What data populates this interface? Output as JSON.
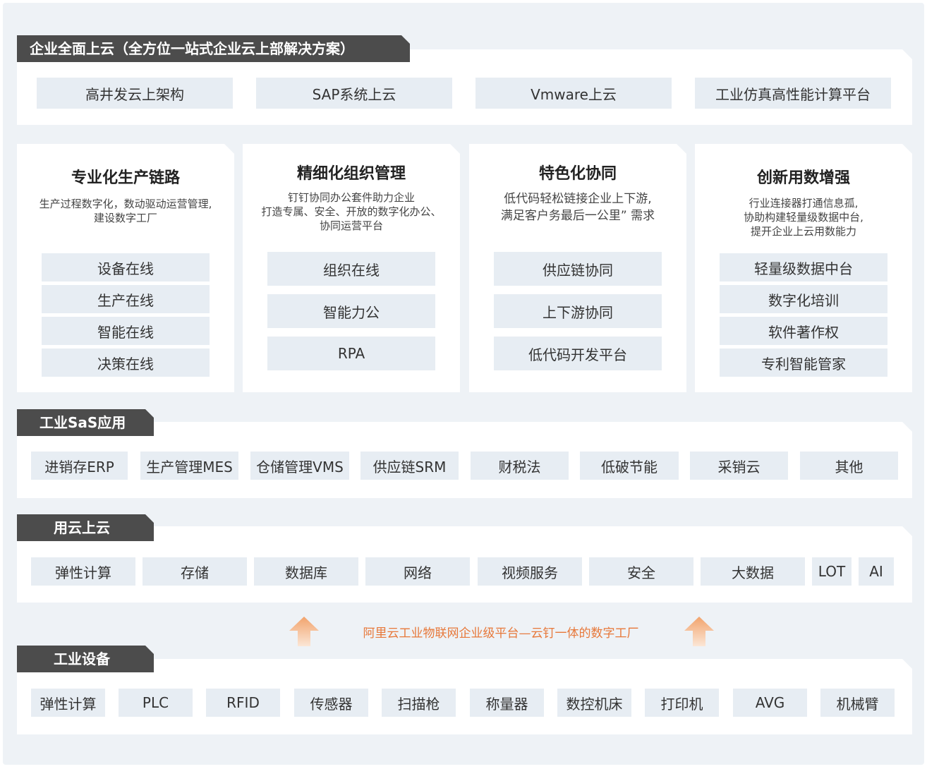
{
  "cloud_section": {
    "title": "企业全面上云（全方位一站式企业云上部解决方案）",
    "items": [
      "高井发云上架构",
      "SAP系统上云",
      "Vmware上云",
      "工业仿真高性能计算平台"
    ]
  },
  "cards": [
    {
      "title": "专业化生产链路",
      "desc": [
        "生产过程数字化，数动驱动运营管理,",
        "建设数字工厂"
      ],
      "items": [
        "设备在线",
        "生产在线",
        "智能在线",
        "决策在线"
      ]
    },
    {
      "title": "精细化组织管理",
      "desc": [
        "钉钉协同办公套件助力企业",
        "打造专属、安全、开放的数字化办公、",
        "协同运营平台"
      ],
      "items": [
        "组织在线",
        "智能力公",
        "RPA"
      ]
    },
    {
      "title": "特色化协同",
      "desc": [
        "低代码轻松链接企业上下游,",
        "满足客户务最后一公里” 需求"
      ],
      "items": [
        "供应链协同",
        "上下游协同",
        "低代码开发平台"
      ]
    },
    {
      "title": "创新用数增强",
      "desc": [
        "行业连接器打通信息孤,",
        "协助构建轻量级数据中台,",
        "提开企业上云用数能力"
      ],
      "items": [
        "轻量级数据中台",
        "数字化培训",
        "软件著作权",
        "专利智能管家"
      ]
    }
  ],
  "saas_section": {
    "title": "工业SaS应用",
    "items": [
      "进销存ERP",
      "生产管理MES",
      "仓储管理VMS",
      "供应链SRM",
      "财税法",
      "低破节能",
      "采销云",
      "其他"
    ]
  },
  "usecloud_section": {
    "title": "用云上云",
    "items": [
      "弹性计算",
      "存储",
      "数据库",
      "网络",
      "视频服务",
      "安全",
      "大数据",
      "LOT",
      "AI"
    ]
  },
  "banner": "阿里云工业物联网企业级平台—云钉一体的数字工厂",
  "device_section": {
    "title": "工业设备",
    "items": [
      "弹性计算",
      "PLC",
      "RFID",
      "传感器",
      "扫描枪",
      "称量器",
      "数控机床",
      "打印机",
      "AVG",
      "机械臂"
    ]
  },
  "colors": {
    "tab": "#4c4c4c",
    "pill": "#e7edf3",
    "background": "#eef2f6",
    "banner": "#e7783a"
  },
  "icons": [
    "up-arrow-icon",
    "up-arrow-icon"
  ]
}
